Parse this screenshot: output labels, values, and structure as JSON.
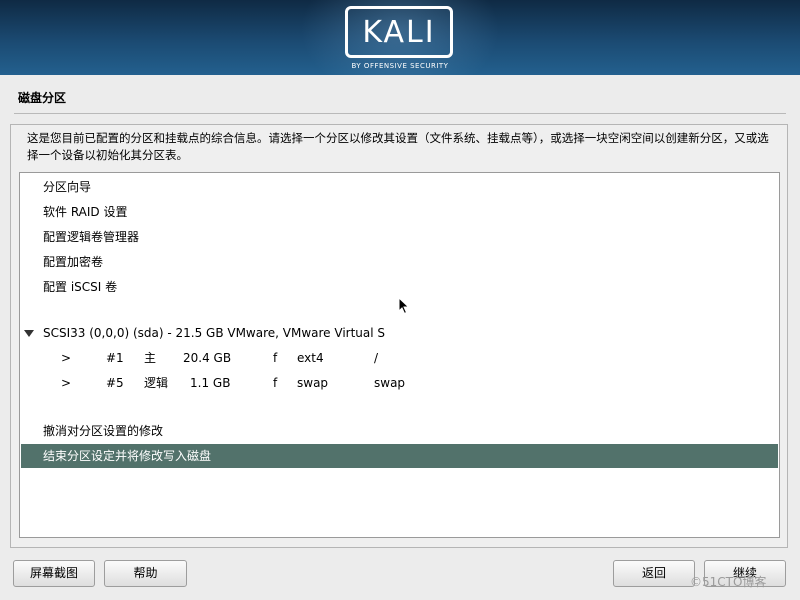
{
  "header": {
    "logo_text": "KALI",
    "logo_subtext": "BY OFFENSIVE SECURITY",
    "colors": {
      "banner_top": "#0f2a44",
      "banner_bottom": "#23608e"
    }
  },
  "page": {
    "title": "磁盘分区",
    "description": "这是您目前已配置的分区和挂载点的综合信息。请选择一个分区以修改其设置（文件系统、挂载点等），或选择一块空闲空间以创建新分区，又或选择一个设备以初始化其分区表。"
  },
  "menu_items": [
    {
      "label": "分区向导"
    },
    {
      "label": "软件 RAID 设置"
    },
    {
      "label": "配置逻辑卷管理器"
    },
    {
      "label": "配置加密卷"
    },
    {
      "label": "配置 iSCSI 卷"
    }
  ],
  "disk": {
    "label": "SCSI33 (0,0,0) (sda) - 21.5 GB VMware, VMware Virtual S",
    "partitions": [
      {
        "marker": ">",
        "number": "#1",
        "type": "主",
        "size": "20.4 GB",
        "flag": "f",
        "fs": "ext4",
        "mount": "/"
      },
      {
        "marker": ">",
        "number": "#5",
        "type": "逻辑",
        "size": "1.1 GB",
        "flag": "f",
        "fs": "swap",
        "mount": "swap"
      }
    ]
  },
  "actions": {
    "undo": "撤消对分区设置的修改",
    "finish": "结束分区设定并将修改写入磁盘"
  },
  "selected_color": "#52726b",
  "buttons": {
    "screenshot": "屏幕截图",
    "help": "帮助",
    "back": "返回",
    "continue": "继续"
  },
  "watermark": "©51CTO博客"
}
